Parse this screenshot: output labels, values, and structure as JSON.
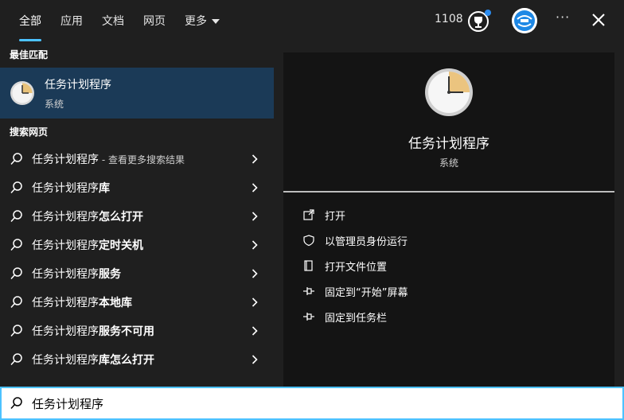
{
  "topbar": {
    "tabs": [
      {
        "label": "全部"
      },
      {
        "label": "应用"
      },
      {
        "label": "文档"
      },
      {
        "label": "网页"
      },
      {
        "label": "更多"
      }
    ],
    "points": "1108",
    "rewards_icon": "rewards-trophy-icon",
    "more_label": "···",
    "close_icon": "close-icon"
  },
  "left": {
    "best_match_label": "最佳匹配",
    "best_match": {
      "title": "任务计划程序",
      "subtitle": "系统",
      "icon": "clock-icon"
    },
    "web_label": "搜索网页",
    "results": [
      {
        "main": "任务计划程序",
        "suffix": "",
        "hint": " - 查看更多搜索结果"
      },
      {
        "main": "任务计划程序",
        "suffix": "库",
        "hint": ""
      },
      {
        "main": "任务计划程序",
        "suffix": "怎么打开",
        "hint": ""
      },
      {
        "main": "任务计划程序",
        "suffix": "定时关机",
        "hint": ""
      },
      {
        "main": "任务计划程序",
        "suffix": "服务",
        "hint": ""
      },
      {
        "main": "任务计划程序",
        "suffix": "本地库",
        "hint": ""
      },
      {
        "main": "任务计划程序",
        "suffix": "服务不可用",
        "hint": ""
      },
      {
        "main": "任务计划程序",
        "suffix": "库怎么打开",
        "hint": ""
      }
    ]
  },
  "right": {
    "title": "任务计划程序",
    "type": "系统",
    "actions": [
      {
        "label": "打开",
        "icon": "open-icon"
      },
      {
        "label": "以管理员身份运行",
        "icon": "shield-icon"
      },
      {
        "label": "打开文件位置",
        "icon": "file-location-icon"
      },
      {
        "label": "固定到“开始”屏幕",
        "icon": "pin-icon"
      },
      {
        "label": "固定到任务栏",
        "icon": "pin-icon"
      }
    ]
  },
  "search": {
    "value": "任务计划程序",
    "icon": "search-icon"
  },
  "colors": {
    "accent": "#4cc2ff",
    "selected": "#1b3a57",
    "panel": "#141414",
    "background": "#1f1f1f"
  }
}
